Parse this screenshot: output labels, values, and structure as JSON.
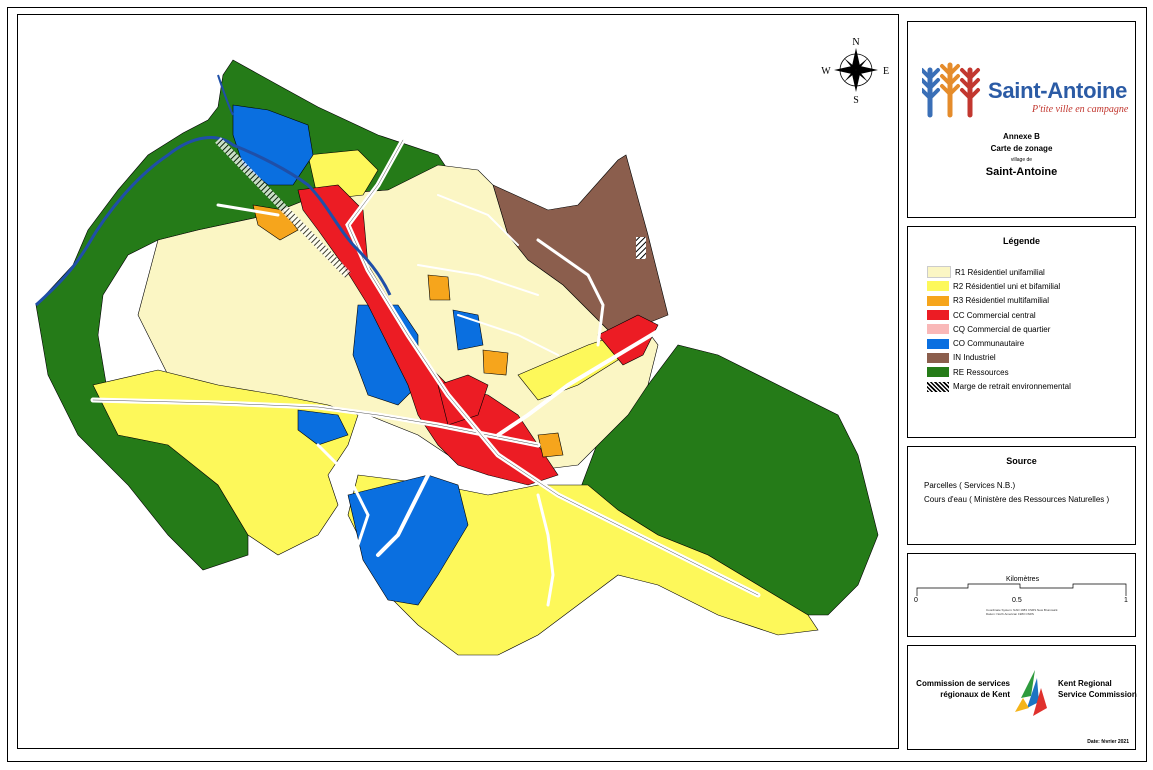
{
  "title_block": {
    "logo_text": "Saint-Antoine",
    "tagline": "P'tite ville en campagne",
    "annexe": "Annexe B",
    "map_title": "Carte de zonage",
    "village_label": "village de",
    "village_name": "Saint-Antoine"
  },
  "compass": {
    "n": "N",
    "s": "S",
    "e": "E",
    "w": "W"
  },
  "legend": {
    "heading": "Légende",
    "items": [
      {
        "code": "R1",
        "label": "R1 Résidentiel unifamilial",
        "color": "#fbf6c4"
      },
      {
        "code": "R2",
        "label": "R2 Résidentiel uni et bifamilial",
        "color": "#fdf85a"
      },
      {
        "code": "R3",
        "label": "R3 Résidentiel multifamilial",
        "color": "#f6a51c"
      },
      {
        "code": "CC",
        "label": "CC Commercial central",
        "color": "#ec1c24"
      },
      {
        "code": "CQ",
        "label": "CQ Commercial de quartier",
        "color": "#f9b8b8"
      },
      {
        "code": "CO",
        "label": "CO Communautaire",
        "color": "#0a6fe0"
      },
      {
        "code": "IN",
        "label": "IN Industriel",
        "color": "#8b5e4d"
      },
      {
        "code": "RE",
        "label": "RE Ressources",
        "color": "#257b18"
      },
      {
        "code": "MR",
        "label": "Marge de retrait environnemental",
        "color": "hatch"
      }
    ]
  },
  "source": {
    "heading": "Source",
    "lines": [
      "Parcelles ( Services N.B.)",
      "Cours d'eau ( Ministère des Ressources Naturelles )"
    ]
  },
  "scale": {
    "title": "Kilomètres",
    "ticks": [
      "0",
      "0.5",
      "1"
    ],
    "fine_print_1": "Coordinate System: NAD 1983 CSRS New Brunswick",
    "fine_print_2": "Datum: North American 1983 CSRS"
  },
  "credits": {
    "fr_line1": "Commission de services",
    "fr_line2": "régionaux de Kent",
    "en_line1": "Kent Regional",
    "en_line2": "Service Commission",
    "date": "Date: février 2021"
  }
}
